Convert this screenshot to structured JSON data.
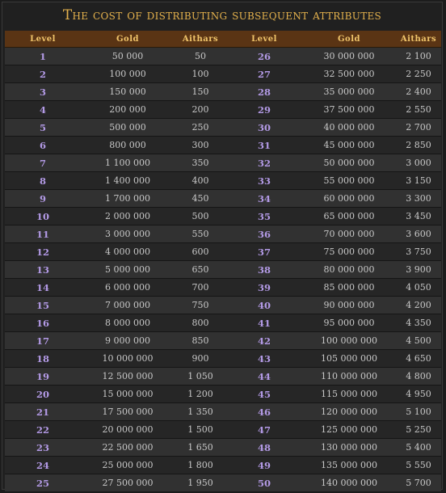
{
  "title": "The cost of distributing subsequent attributes",
  "headers": [
    "Level",
    "Gold",
    "Aithars",
    "Level",
    "Gold",
    "Aithars"
  ],
  "rows": [
    [
      "1",
      "50 000",
      "50",
      "26",
      "30 000 000",
      "2 100"
    ],
    [
      "2",
      "100 000",
      "100",
      "27",
      "32 500 000",
      "2 250"
    ],
    [
      "3",
      "150 000",
      "150",
      "28",
      "35 000 000",
      "2 400"
    ],
    [
      "4",
      "200 000",
      "200",
      "29",
      "37 500 000",
      "2 550"
    ],
    [
      "5",
      "500 000",
      "250",
      "30",
      "40 000 000",
      "2 700"
    ],
    [
      "6",
      "800 000",
      "300",
      "31",
      "45 000 000",
      "2 850"
    ],
    [
      "7",
      "1 100 000",
      "350",
      "32",
      "50 000 000",
      "3 000"
    ],
    [
      "8",
      "1 400 000",
      "400",
      "33",
      "55 000 000",
      "3 150"
    ],
    [
      "9",
      "1 700 000",
      "450",
      "34",
      "60 000 000",
      "3 300"
    ],
    [
      "10",
      "2 000 000",
      "500",
      "35",
      "65 000 000",
      "3 450"
    ],
    [
      "11",
      "3 000 000",
      "550",
      "36",
      "70 000 000",
      "3 600"
    ],
    [
      "12",
      "4 000 000",
      "600",
      "37",
      "75 000 000",
      "3 750"
    ],
    [
      "13",
      "5 000 000",
      "650",
      "38",
      "80 000 000",
      "3 900"
    ],
    [
      "14",
      "6 000 000",
      "700",
      "39",
      "85 000 000",
      "4 050"
    ],
    [
      "15",
      "7 000 000",
      "750",
      "40",
      "90 000 000",
      "4 200"
    ],
    [
      "16",
      "8 000 000",
      "800",
      "41",
      "95 000 000",
      "4 350"
    ],
    [
      "17",
      "9 000 000",
      "850",
      "42",
      "100 000 000",
      "4 500"
    ],
    [
      "18",
      "10 000 000",
      "900",
      "43",
      "105 000 000",
      "4 650"
    ],
    [
      "19",
      "12 500 000",
      "1 050",
      "44",
      "110 000 000",
      "4 800"
    ],
    [
      "20",
      "15 000 000",
      "1 200",
      "45",
      "115 000 000",
      "4 950"
    ],
    [
      "21",
      "17 500 000",
      "1 350",
      "46",
      "120 000 000",
      "5 100"
    ],
    [
      "22",
      "20 000 000",
      "1 500",
      "47",
      "125 000 000",
      "5 250"
    ],
    [
      "23",
      "22 500 000",
      "1 650",
      "48",
      "130 000 000",
      "5 400"
    ],
    [
      "24",
      "25 000 000",
      "1 800",
      "49",
      "135 000 000",
      "5 550"
    ],
    [
      "25",
      "27 500 000",
      "1 950",
      "50",
      "140 000 000",
      "5 700"
    ]
  ],
  "colors": {
    "title": "#e5b24d",
    "header_bg": "#5a3414",
    "header_text": "#f0c46a",
    "level_text": "#b39ae6",
    "cell_text": "#c8c8c8"
  }
}
